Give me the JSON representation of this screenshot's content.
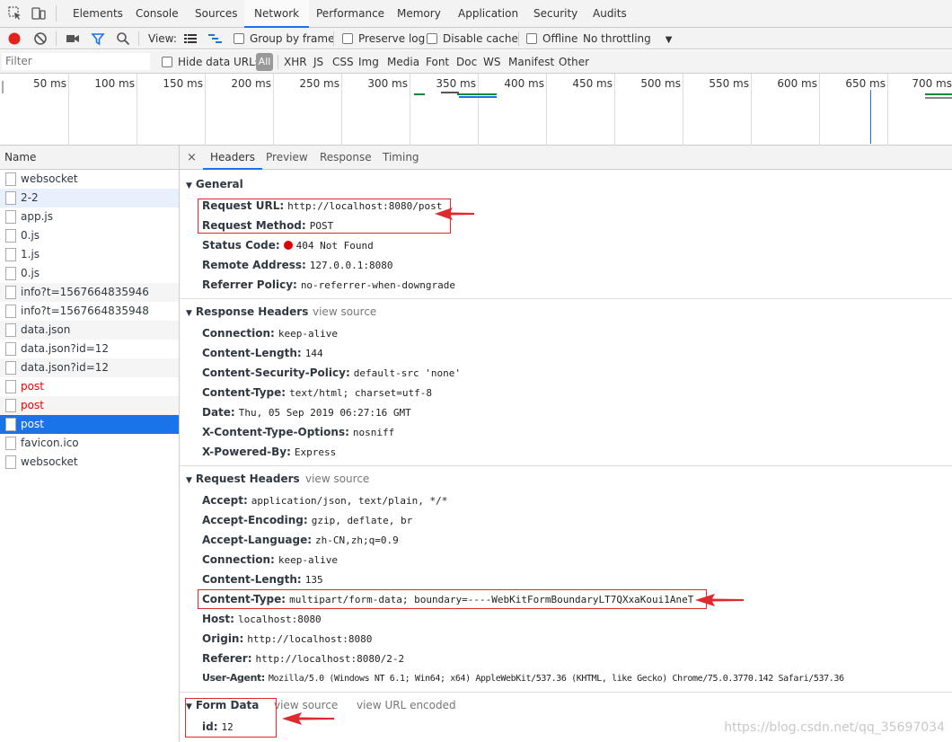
{
  "tabs": [
    "Elements",
    "Console",
    "Sources",
    "Network",
    "Performance",
    "Memory",
    "Application",
    "Security",
    "Audits"
  ],
  "toolbar": {
    "view_label": "View:",
    "group_by_frame": "Group by frame",
    "preserve_log": "Preserve log",
    "disable_cache": "Disable cache",
    "offline": "Offline",
    "throttling": "No throttling"
  },
  "filter": {
    "placeholder": "Filter",
    "hide_data_urls": "Hide data URLs",
    "all": "All",
    "types": [
      "XHR",
      "JS",
      "CSS",
      "Img",
      "Media",
      "Font",
      "Doc",
      "WS",
      "Manifest",
      "Other"
    ]
  },
  "timeline": {
    "ticks": [
      "50 ms",
      "100 ms",
      "150 ms",
      "200 ms",
      "250 ms",
      "300 ms",
      "350 ms",
      "400 ms",
      "450 ms",
      "500 ms",
      "550 ms",
      "600 ms",
      "650 ms",
      "700 ms"
    ]
  },
  "requests": {
    "header": "Name",
    "items": [
      "websocket",
      "2-2",
      "app.js",
      "0.js",
      "1.js",
      "0.js",
      "info?t=1567664835946",
      "info?t=1567664835948",
      "data.json",
      "data.json?id=12",
      "data.json?id=12",
      "post",
      "post",
      "post",
      "favicon.ico",
      "websocket"
    ]
  },
  "details_tabs": {
    "close": "×",
    "items": [
      "Headers",
      "Preview",
      "Response",
      "Timing"
    ]
  },
  "general": {
    "title": "General",
    "request_url_key": "Request URL:",
    "request_url": "http://localhost:8080/post",
    "request_method_key": "Request Method:",
    "request_method": "POST",
    "status_code_key": "Status Code:",
    "status_code": "404 Not Found",
    "remote_address_key": "Remote Address:",
    "remote_address": "127.0.0.1:8080",
    "referrer_policy_key": "Referrer Policy:",
    "referrer_policy": "no-referrer-when-downgrade"
  },
  "response_headers": {
    "title": "Response Headers",
    "view_source": "view source",
    "rows": [
      {
        "k": "Connection:",
        "v": "keep-alive"
      },
      {
        "k": "Content-Length:",
        "v": "144"
      },
      {
        "k": "Content-Security-Policy:",
        "v": "default-src 'none'"
      },
      {
        "k": "Content-Type:",
        "v": "text/html; charset=utf-8"
      },
      {
        "k": "Date:",
        "v": "Thu, 05 Sep 2019 06:27:16 GMT"
      },
      {
        "k": "X-Content-Type-Options:",
        "v": "nosniff"
      },
      {
        "k": "X-Powered-By:",
        "v": "Express"
      }
    ]
  },
  "request_headers": {
    "title": "Request Headers",
    "view_source": "view source",
    "rows": [
      {
        "k": "Accept:",
        "v": "application/json, text/plain, */*"
      },
      {
        "k": "Accept-Encoding:",
        "v": "gzip, deflate, br"
      },
      {
        "k": "Accept-Language:",
        "v": "zh-CN,zh;q=0.9"
      },
      {
        "k": "Connection:",
        "v": "keep-alive"
      },
      {
        "k": "Content-Length:",
        "v": "135"
      },
      {
        "k": "Content-Type:",
        "v": "multipart/form-data; boundary=----WebKitFormBoundaryLT7QXxaKoui1AneT"
      },
      {
        "k": "Host:",
        "v": "localhost:8080"
      },
      {
        "k": "Origin:",
        "v": "http://localhost:8080"
      },
      {
        "k": "Referer:",
        "v": "http://localhost:8080/2-2"
      },
      {
        "k": "User-Agent:",
        "v": "Mozilla/5.0 (Windows NT 6.1; Win64; x64) AppleWebKit/537.36 (KHTML, like Gecko) Chrome/75.0.3770.142 Safari/537.36"
      }
    ]
  },
  "form_data": {
    "title": "Form Data",
    "view_source": "view source",
    "view_url_encoded": "view URL encoded",
    "key": "id:",
    "value": "12"
  },
  "watermark": "https://blog.csdn.net/qq_35697034",
  "colors": {
    "accent": "#1a73e8",
    "annotation": "#e0292e",
    "error_text": "#e00"
  }
}
